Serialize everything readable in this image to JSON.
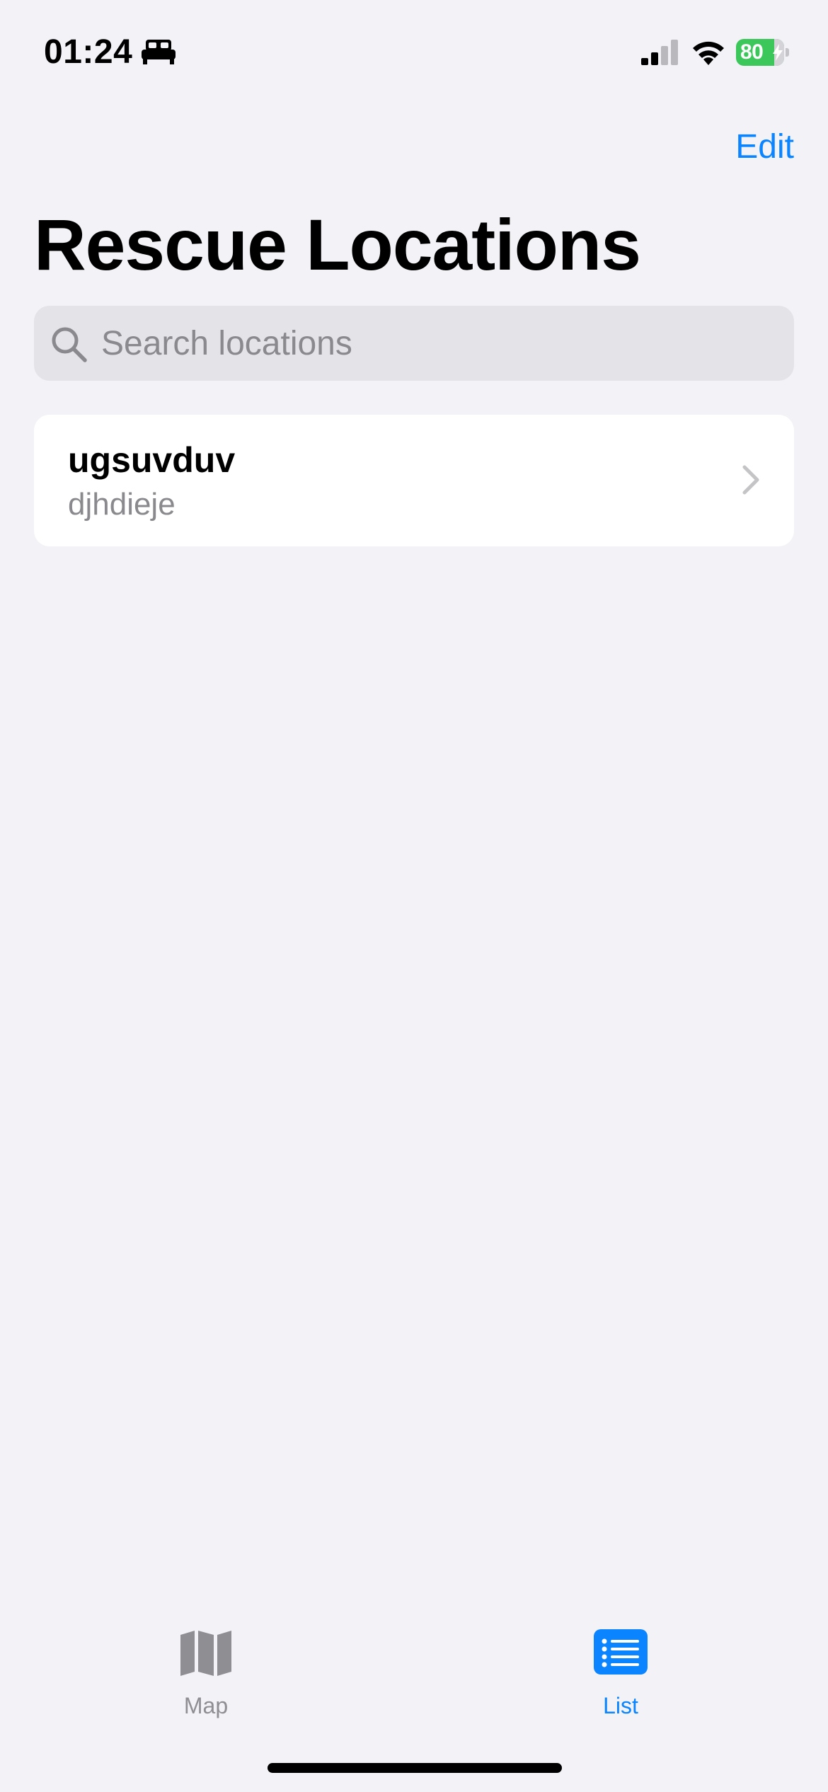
{
  "status_bar": {
    "time": "01:24",
    "battery_percent": "80",
    "battery_level": 0.8,
    "charging": true,
    "icons": [
      "bed-icon",
      "cellular-signal-icon",
      "wifi-icon",
      "battery-charging-icon"
    ]
  },
  "nav": {
    "edit_label": "Edit",
    "title": "Rescue Locations"
  },
  "search": {
    "placeholder": "Search locations",
    "value": "",
    "icon": "magnifying-glass-icon"
  },
  "locations": [
    {
      "name": "ugsuvduv",
      "subtitle": "djhdieje",
      "accessory": "chevron-right-icon"
    }
  ],
  "tab_bar": {
    "tabs": [
      {
        "label": "Map",
        "icon": "map-icon",
        "selected": false
      },
      {
        "label": "List",
        "icon": "list-icon",
        "selected": true
      }
    ]
  },
  "colors": {
    "background": "#F2F2F7",
    "accent": "#0A84FF",
    "card": "#FFFFFF",
    "search_field": "#E3E3E8",
    "secondary_text": "#8A8A8E",
    "inactive_tab": "#8E8E93",
    "battery_green": "#3CC75A"
  }
}
